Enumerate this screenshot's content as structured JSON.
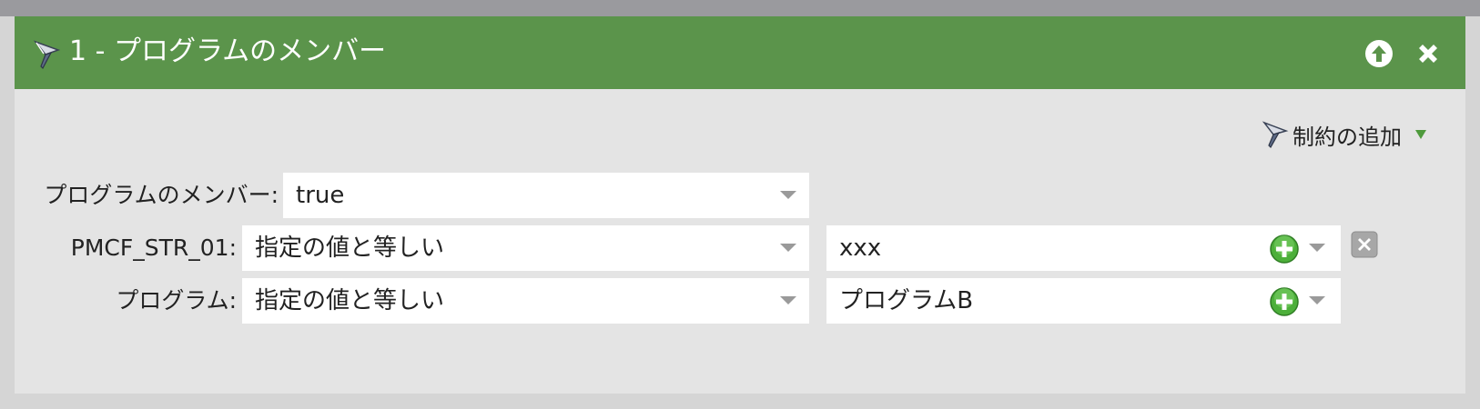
{
  "filter": {
    "title": "1 - プログラムのメンバー",
    "icons": {
      "filter": "funnel-icon",
      "move_up": "arrow-up-circle-icon",
      "close": "close-x-icon"
    },
    "add_constraint": {
      "label": "制約の追加",
      "icon": "funnel-icon",
      "dropdown": "triangle-down-icon"
    },
    "member_row": {
      "label": "プログラムのメンバー:",
      "value": "true"
    },
    "constraints": [
      {
        "label": "PMCF_STR_01:",
        "operator": "指定の値と等しい",
        "value": "xxx"
      },
      {
        "label": "プログラム:",
        "operator": "指定の値と等しい",
        "value": "プログラムB"
      }
    ]
  },
  "colors": {
    "header": "#5b944b",
    "panel": "#e4e4e4",
    "plus_green": "#4caf3a"
  }
}
